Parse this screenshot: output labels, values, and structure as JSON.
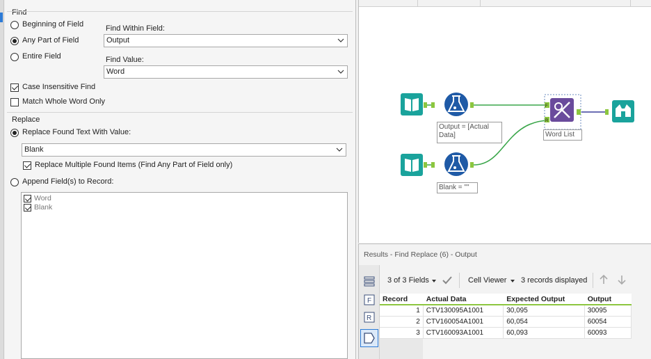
{
  "find": {
    "section_title": "Find",
    "options": [
      "Beginning of Field",
      "Any Part of Field",
      "Entire Field"
    ],
    "selected_option": "Any Part of Field",
    "find_within_label": "Find Within Field:",
    "find_within_value": "Output",
    "find_value_label": "Find Value:",
    "find_value_value": "Word",
    "case_insensitive_label": "Case Insensitive Find",
    "case_insensitive_checked": true,
    "match_whole_word_label": "Match Whole Word Only",
    "match_whole_word_checked": false
  },
  "replace": {
    "section_title": "Replace",
    "replace_found_label": "Replace Found Text With Value:",
    "replace_found_selected": true,
    "replace_value": "Blank",
    "replace_multiple_label": "Replace Multiple Found Items (Find Any Part of Field only)",
    "replace_multiple_checked": true,
    "append_label": "Append Field(s) to Record:",
    "append_fields": [
      {
        "label": "Word",
        "checked": true
      },
      {
        "label": "Blank",
        "checked": true
      }
    ]
  },
  "canvas": {
    "formula1_caption": "Output = [Actual\nData]",
    "formula2_caption": "Blank = \"\"",
    "find_replace_caption": "Word List",
    "anchor_f": "F",
    "anchor_r": "R",
    "tool_color": "#1aa39c",
    "formula_color": "#1f5aa6",
    "join_color": "#6a4b9c",
    "connector_green": "#3aa64a",
    "connector_blue": "#3b3f9c"
  },
  "results": {
    "title": "Results - Find Replace (6) - Output",
    "fields_selector": "3 of 3 Fields",
    "cell_viewer": "Cell Viewer",
    "records_displayed": "3 records displayed",
    "columns": [
      "Record",
      "Actual Data",
      "Expected Output",
      "Output"
    ],
    "rows": [
      [
        "1",
        "CTV130095A1001",
        "30,095",
        "30095"
      ],
      [
        "2",
        "CTV160054A1001",
        "60,054",
        "60054"
      ],
      [
        "3",
        "CTV160093A1001",
        "60,093",
        "60093"
      ]
    ]
  }
}
